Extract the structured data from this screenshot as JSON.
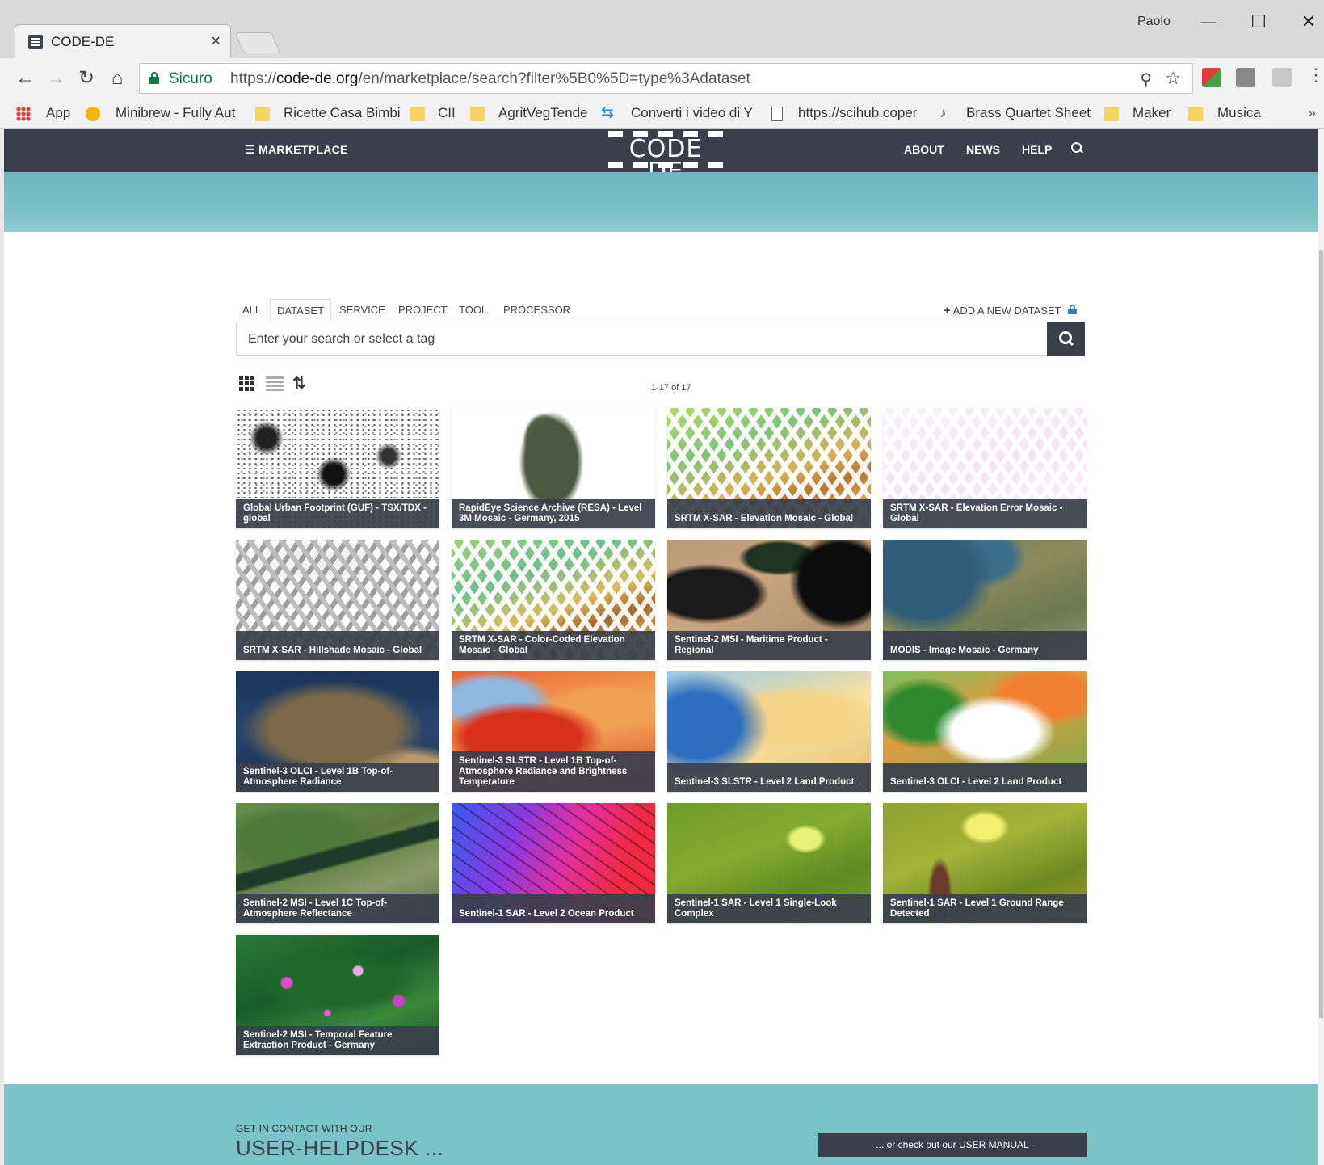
{
  "browser": {
    "tab_title": "CODE-DE",
    "tab_close": "×",
    "user": "Paolo",
    "win_min": "—",
    "win_max": "☐",
    "win_close": "✕",
    "secure_label": "Sicuro",
    "url_scheme": "https://",
    "url_host": "code-de.org",
    "url_path": "/en/marketplace/search?filter%5B0%5D=type%3Adataset",
    "bookmarks": [
      {
        "label": "App",
        "icon": "apps-icon"
      },
      {
        "label": "Minibrew - Fully Aut",
        "icon": "dot-icon"
      },
      {
        "label": "Ricette Casa Bimbi",
        "icon": "folder-icon"
      },
      {
        "label": "CII",
        "icon": "folder-icon"
      },
      {
        "label": "AgritVegTende",
        "icon": "folder-icon"
      },
      {
        "label": "Converti i video di Y",
        "icon": "convert-icon"
      },
      {
        "label": "https://scihub.coper",
        "icon": "page-icon"
      },
      {
        "label": "Brass Quartet Sheet",
        "icon": "note-icon"
      },
      {
        "label": "Maker",
        "icon": "folder-icon"
      },
      {
        "label": "Musica",
        "icon": "folder-icon"
      }
    ],
    "bookmarks_more": "»"
  },
  "header": {
    "marketplace": "MARKETPLACE",
    "logo_text": "CODE DE",
    "nav": [
      "ABOUT",
      "NEWS",
      "HELP"
    ]
  },
  "filters": {
    "tabs": [
      "ALL",
      "DATASET",
      "SERVICE",
      "PROJECT",
      "TOOL",
      "PROCESSOR"
    ],
    "active": "DATASET",
    "add_label": "ADD A NEW DATASET"
  },
  "search": {
    "placeholder": "Enter your search or select a tag"
  },
  "results": {
    "count": "1-17 of 17",
    "sort_glyph": "⇅"
  },
  "cards": [
    {
      "title": "Global Urban Footprint (GUF) - TSX/TDX - global",
      "thumb": "t-guf"
    },
    {
      "title": "RapidEye Science Archive (RESA) - Level 3M Mosaic - Germany, 2015",
      "thumb": "t-resa"
    },
    {
      "title": "SRTM X-SAR - Elevation Mosaic - Global",
      "thumb": "t-srtm-el"
    },
    {
      "title": "SRTM X-SAR - Elevation Error Mosaic - Global",
      "thumb": "t-srtm-err"
    },
    {
      "title": "SRTM X-SAR - Hillshade Mosaic - Global",
      "thumb": "t-srtm-hill"
    },
    {
      "title": "SRTM X-SAR - Color-Coded Elevation Mosaic - Global",
      "thumb": "t-srtm-cc"
    },
    {
      "title": "Sentinel-2 MSI - Maritime Product - Regional",
      "thumb": "t-maritime"
    },
    {
      "title": "MODIS - Image Mosaic - Germany",
      "thumb": "t-modis"
    },
    {
      "title": "Sentinel-3 OLCI - Level 1B Top-of-Atmosphere Radiance",
      "thumb": "t-olci1b"
    },
    {
      "title": "Sentinel-3 SLSTR - Level 1B Top-of-Atmosphere Radiance and Brightness Temperature",
      "thumb": "t-slstr1b"
    },
    {
      "title": "Sentinel-3 SLSTR - Level 2 Land Product",
      "thumb": "t-slstr2"
    },
    {
      "title": "Sentinel-3 OLCI - Level 2 Land Product",
      "thumb": "t-olci2"
    },
    {
      "title": "Sentinel-2 MSI - Level 1C Top-of-Atmosphere Reflectance",
      "thumb": "t-msi1c"
    },
    {
      "title": "Sentinel-1 SAR - Level 2 Ocean Product",
      "thumb": "t-ocean"
    },
    {
      "title": "Sentinel-1 SAR - Level 1 Single-Look Complex",
      "thumb": "t-slc"
    },
    {
      "title": "Sentinel-1 SAR - Level 1 Ground Range Detected",
      "thumb": "t-grd"
    },
    {
      "title": "Sentinel-2 MSI - Temporal Feature Extraction Product - Germany",
      "thumb": "t-temporal"
    }
  ],
  "footer": {
    "small": "GET IN CONTACT WITH OUR",
    "big": "USER-HELPDESK ...",
    "manual": "... or check out our USER MANUAL"
  },
  "colors": {
    "header_bg": "#3a3f4b",
    "teal": "#7bc1c8"
  }
}
